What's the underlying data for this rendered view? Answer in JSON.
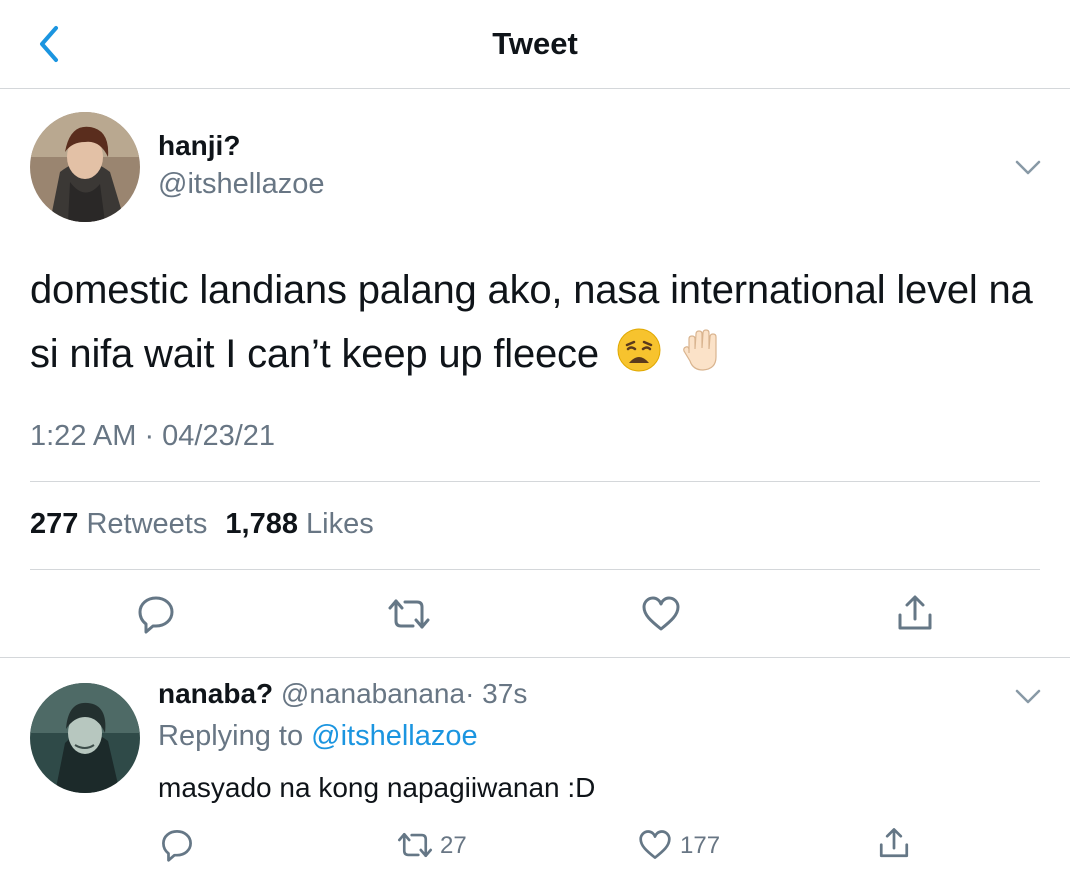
{
  "header": {
    "title": "Tweet"
  },
  "tweet": {
    "display_name": "hanji?",
    "handle": "@itshellazoe",
    "text": "domestic landians palang ako, nasa international level na si nifa wait I can’t keep up fleece",
    "emojis": [
      "weary-face-emoji",
      "raised-hand-emoji"
    ],
    "timestamp": "1:22 AM · 04/23/21",
    "retweets": "277",
    "retweets_label": "Retweets",
    "likes": "1,788",
    "likes_label": "Likes"
  },
  "reply": {
    "display_name": "nanaba?",
    "handle": "@nanabanana",
    "time": "· 37s",
    "replying_prefix": "Replying to",
    "replying_to": "@itshellazoe",
    "text": "masyado na kong napagiiwanan :D",
    "retweet_count": "27",
    "like_count": "177"
  },
  "colors": {
    "accent": "#1b95e0",
    "secondary_text": "#687684",
    "border": "#d4d7da",
    "icon": "#657786"
  },
  "icons": [
    "back-chevron-icon",
    "caret-down-icon",
    "reply-icon",
    "retweet-icon",
    "like-icon",
    "share-icon"
  ]
}
